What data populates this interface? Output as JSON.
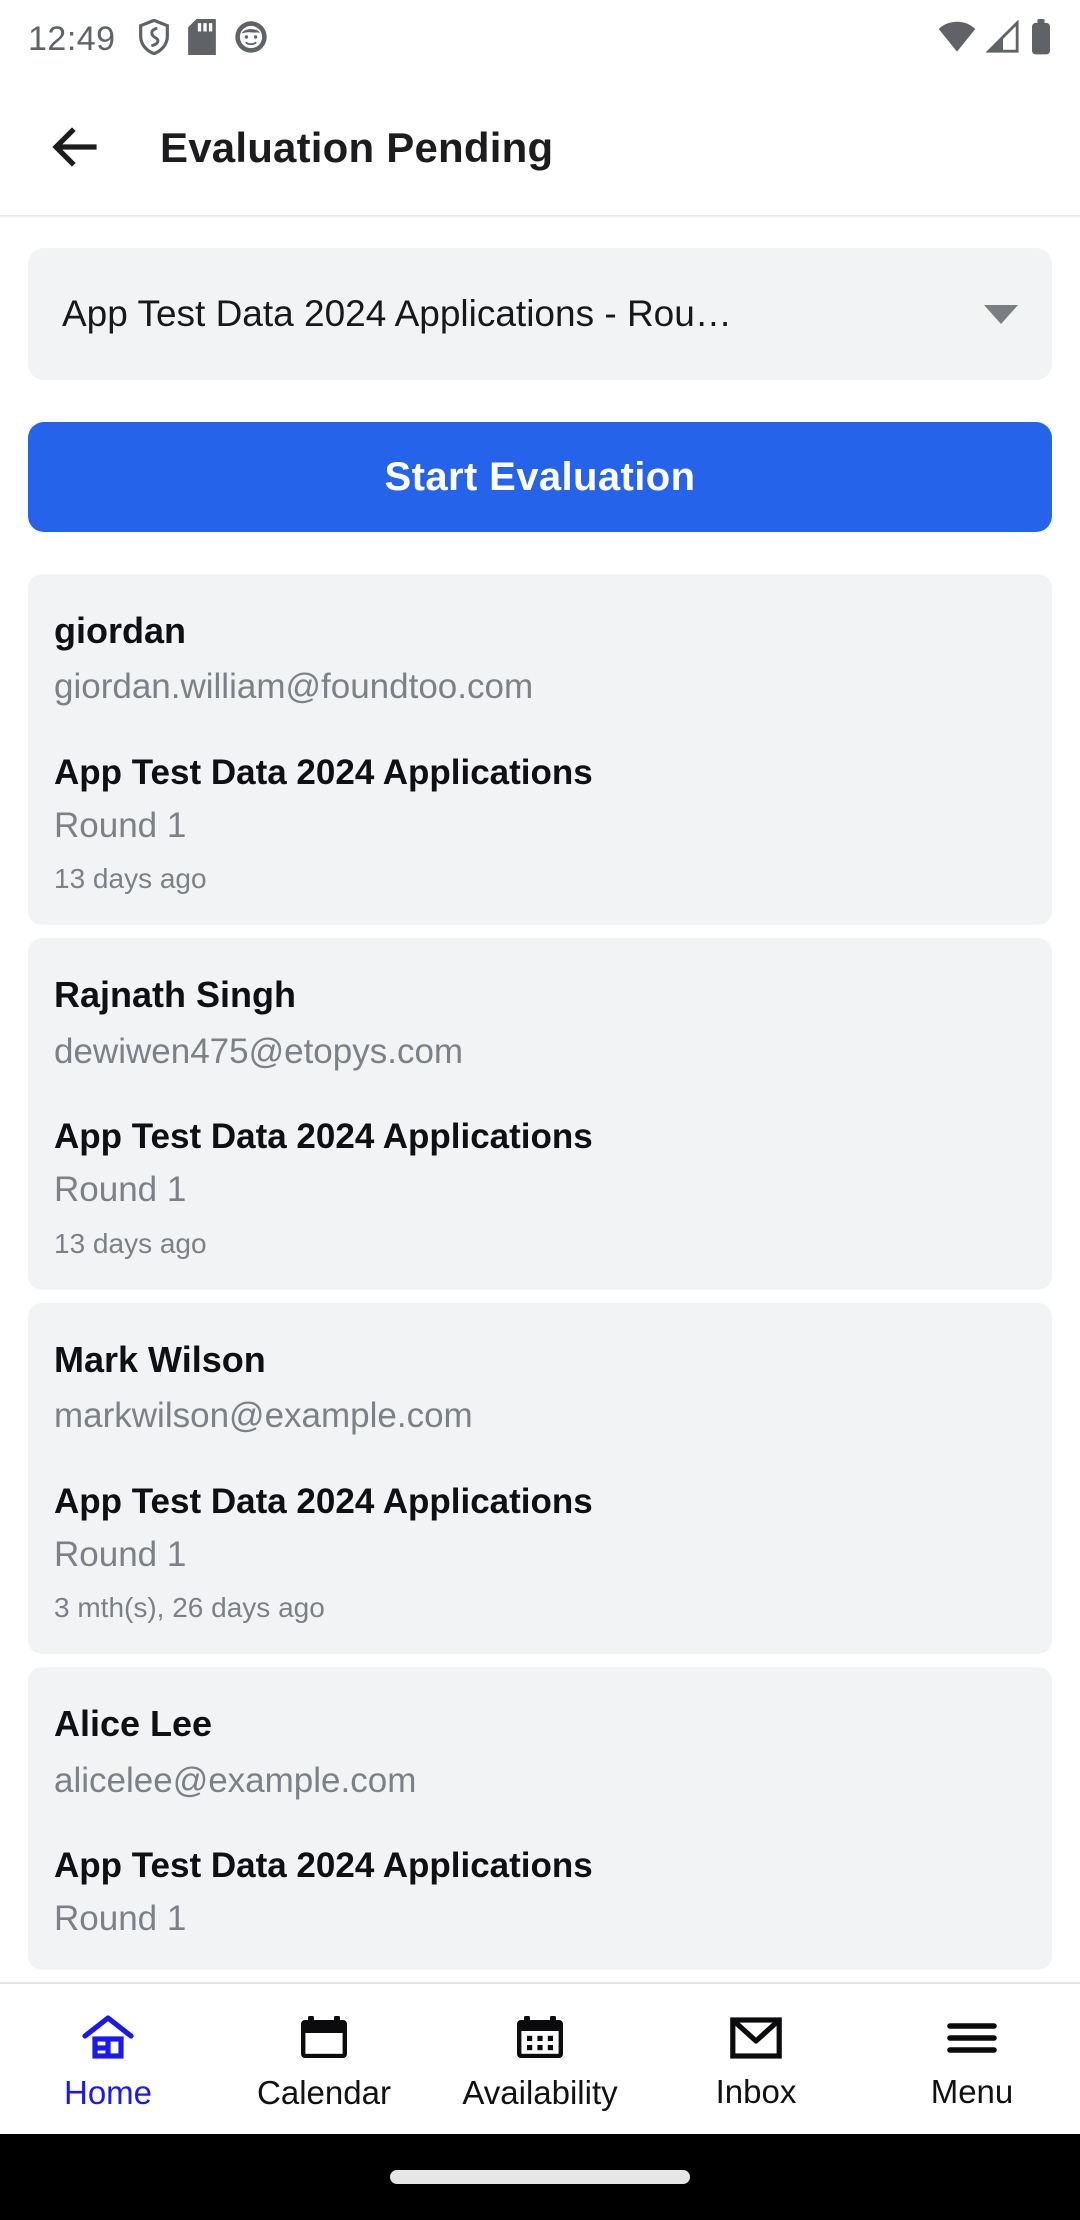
{
  "status_bar": {
    "time": "12:49",
    "left_icons": [
      "shield-icon",
      "sd-card-icon",
      "app-badge-icon"
    ],
    "right_icons": [
      "wifi-icon",
      "cellular-signal-icon",
      "battery-icon"
    ]
  },
  "app_bar": {
    "back_icon": "back-arrow-icon",
    "title": "Evaluation Pending"
  },
  "program_selector": {
    "value": "App Test Data 2024 Applications - Rou…",
    "caret_icon": "chevron-down-icon"
  },
  "primary_action": {
    "label": "Start Evaluation",
    "color": "#2563EB"
  },
  "applications": [
    {
      "name": "giordan",
      "email": "giordan.william@foundtoo.com",
      "program": "App Test Data 2024 Applications",
      "round": "Round 1",
      "time_ago": "13 days ago"
    },
    {
      "name": "Rajnath Singh",
      "email": "dewiwen475@etopys.com",
      "program": "App Test Data 2024 Applications",
      "round": "Round 1",
      "time_ago": "13 days ago"
    },
    {
      "name": "Mark Wilson",
      "email": "markwilson@example.com",
      "program": "App Test Data 2024 Applications",
      "round": "Round 1",
      "time_ago": "3 mth(s), 26 days ago"
    },
    {
      "name": "Alice Lee",
      "email": "alicelee@example.com",
      "program": "App Test Data 2024 Applications",
      "round": "Round 1",
      "time_ago": ""
    }
  ],
  "bottom_nav": {
    "active_index": 0,
    "active_color": "#1a1af0",
    "items": [
      {
        "label": "Home",
        "icon": "home-icon"
      },
      {
        "label": "Calendar",
        "icon": "calendar-icon"
      },
      {
        "label": "Availability",
        "icon": "calendar-grid-icon"
      },
      {
        "label": "Inbox",
        "icon": "envelope-icon"
      },
      {
        "label": "Menu",
        "icon": "hamburger-menu-icon"
      }
    ]
  },
  "colors": {
    "card_background": "#f2f3f5",
    "muted_text": "#7d8086",
    "primary_text": "#101014"
  }
}
